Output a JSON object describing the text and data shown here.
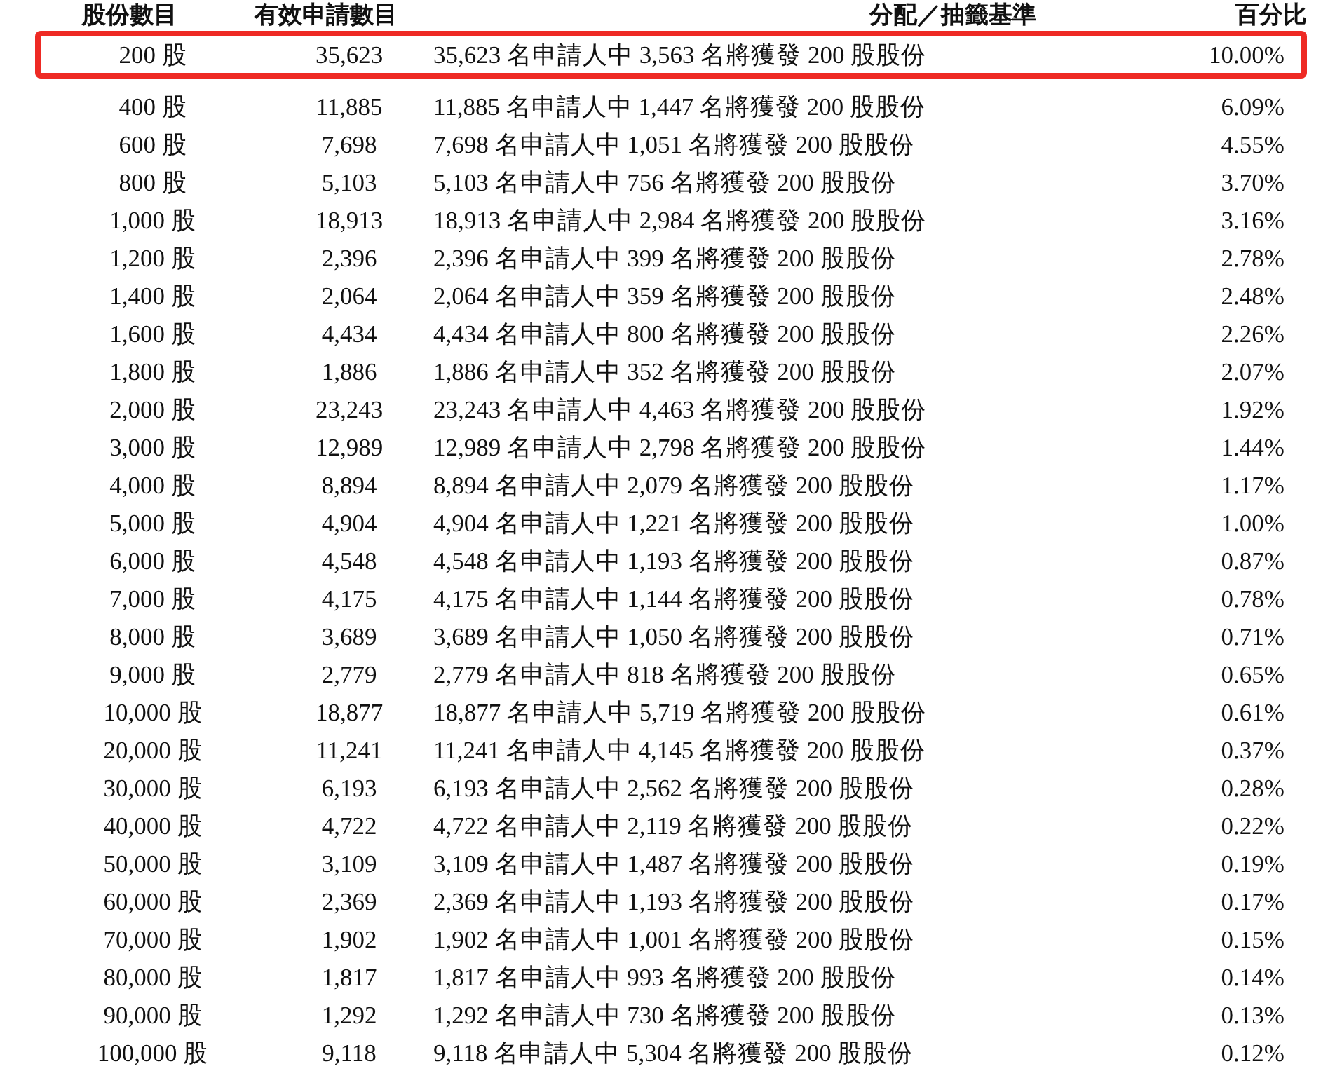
{
  "table": {
    "columns": [
      "股份數目",
      "有效申請數目",
      "分配／抽籤基準",
      "百分比"
    ],
    "rows": [
      {
        "shares": "200 股",
        "applications": "35,623",
        "basis": "35,623 名申請人中 3,563 名將獲發 200 股股份",
        "percentage": "10.00%",
        "highlighted": true
      },
      {
        "shares": "400 股",
        "applications": "11,885",
        "basis": "11,885 名申請人中 1,447 名將獲發 200 股股份",
        "percentage": "6.09%",
        "highlighted": false
      },
      {
        "shares": "600 股",
        "applications": "7,698",
        "basis": "7,698 名申請人中 1,051 名將獲發 200 股股份",
        "percentage": "4.55%",
        "highlighted": false
      },
      {
        "shares": "800 股",
        "applications": "5,103",
        "basis": "5,103 名申請人中 756 名將獲發 200 股股份",
        "percentage": "3.70%",
        "highlighted": false
      },
      {
        "shares": "1,000 股",
        "applications": "18,913",
        "basis": "18,913 名申請人中 2,984 名將獲發 200 股股份",
        "percentage": "3.16%",
        "highlighted": false
      },
      {
        "shares": "1,200 股",
        "applications": "2,396",
        "basis": "2,396 名申請人中 399 名將獲發 200 股股份",
        "percentage": "2.78%",
        "highlighted": false
      },
      {
        "shares": "1,400 股",
        "applications": "2,064",
        "basis": "2,064 名申請人中 359 名將獲發 200 股股份",
        "percentage": "2.48%",
        "highlighted": false
      },
      {
        "shares": "1,600 股",
        "applications": "4,434",
        "basis": "4,434 名申請人中 800 名將獲發 200 股股份",
        "percentage": "2.26%",
        "highlighted": false
      },
      {
        "shares": "1,800 股",
        "applications": "1,886",
        "basis": "1,886 名申請人中 352 名將獲發 200 股股份",
        "percentage": "2.07%",
        "highlighted": false
      },
      {
        "shares": "2,000 股",
        "applications": "23,243",
        "basis": "23,243 名申請人中 4,463 名將獲發 200 股股份",
        "percentage": "1.92%",
        "highlighted": false
      },
      {
        "shares": "3,000 股",
        "applications": "12,989",
        "basis": "12,989 名申請人中 2,798 名將獲發 200 股股份",
        "percentage": "1.44%",
        "highlighted": false
      },
      {
        "shares": "4,000 股",
        "applications": "8,894",
        "basis": "8,894 名申請人中 2,079 名將獲發 200 股股份",
        "percentage": "1.17%",
        "highlighted": false
      },
      {
        "shares": "5,000 股",
        "applications": "4,904",
        "basis": "4,904 名申請人中 1,221 名將獲發 200 股股份",
        "percentage": "1.00%",
        "highlighted": false
      },
      {
        "shares": "6,000 股",
        "applications": "4,548",
        "basis": "4,548 名申請人中 1,193 名將獲發 200 股股份",
        "percentage": "0.87%",
        "highlighted": false
      },
      {
        "shares": "7,000 股",
        "applications": "4,175",
        "basis": "4,175 名申請人中 1,144 名將獲發 200 股股份",
        "percentage": "0.78%",
        "highlighted": false
      },
      {
        "shares": "8,000 股",
        "applications": "3,689",
        "basis": "3,689 名申請人中 1,050 名將獲發 200 股股份",
        "percentage": "0.71%",
        "highlighted": false
      },
      {
        "shares": "9,000 股",
        "applications": "2,779",
        "basis": "2,779 名申請人中 818 名將獲發 200 股股份",
        "percentage": "0.65%",
        "highlighted": false
      },
      {
        "shares": "10,000 股",
        "applications": "18,877",
        "basis": "18,877 名申請人中 5,719 名將獲發 200 股股份",
        "percentage": "0.61%",
        "highlighted": false
      },
      {
        "shares": "20,000 股",
        "applications": "11,241",
        "basis": "11,241 名申請人中 4,145 名將獲發 200 股股份",
        "percentage": "0.37%",
        "highlighted": false
      },
      {
        "shares": "30,000 股",
        "applications": "6,193",
        "basis": "6,193 名申請人中 2,562 名將獲發 200 股股份",
        "percentage": "0.28%",
        "highlighted": false
      },
      {
        "shares": "40,000 股",
        "applications": "4,722",
        "basis": "4,722 名申請人中 2,119 名將獲發 200 股股份",
        "percentage": "0.22%",
        "highlighted": false
      },
      {
        "shares": "50,000 股",
        "applications": "3,109",
        "basis": "3,109 名申請人中 1,487 名將獲發 200 股股份",
        "percentage": "0.19%",
        "highlighted": false
      },
      {
        "shares": "60,000 股",
        "applications": "2,369",
        "basis": "2,369 名申請人中 1,193 名將獲發 200 股股份",
        "percentage": "0.17%",
        "highlighted": false
      },
      {
        "shares": "70,000 股",
        "applications": "1,902",
        "basis": "1,902 名申請人中 1,001 名將獲發 200 股股份",
        "percentage": "0.15%",
        "highlighted": false
      },
      {
        "shares": "80,000 股",
        "applications": "1,817",
        "basis": "1,817 名申請人中 993 名將獲發 200 股股份",
        "percentage": "0.14%",
        "highlighted": false
      },
      {
        "shares": "90,000 股",
        "applications": "1,292",
        "basis": "1,292 名申請人中 730 名將獲發 200 股股份",
        "percentage": "0.13%",
        "highlighted": false
      },
      {
        "shares": "100,000 股",
        "applications": "9,118",
        "basis": "9,118 名申請人中 5,304 名將獲發 200 股股份",
        "percentage": "0.12%",
        "highlighted": false
      }
    ]
  }
}
